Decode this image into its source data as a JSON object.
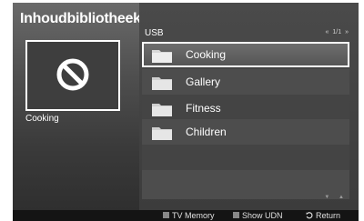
{
  "app": {
    "title": "Inhoudbibliotheek"
  },
  "preview": {
    "caption": "Cooking",
    "icon": "no-content-icon"
  },
  "browser": {
    "source": "USB",
    "pager": {
      "prev": "«",
      "page": "1/1",
      "next": "»"
    },
    "items": [
      {
        "label": "Cooking",
        "icon": "folder-icon",
        "selected": true
      },
      {
        "label": "Gallery",
        "icon": "folder-icon",
        "selected": false
      },
      {
        "label": "Fitness",
        "icon": "folder-icon",
        "selected": false
      },
      {
        "label": "Children",
        "icon": "folder-icon",
        "selected": false
      }
    ],
    "scroll": {
      "down": "▼",
      "up": "▲"
    }
  },
  "footer": {
    "tv_memory": "TV Memory",
    "show_udn": "Show UDN",
    "return": "Return"
  }
}
